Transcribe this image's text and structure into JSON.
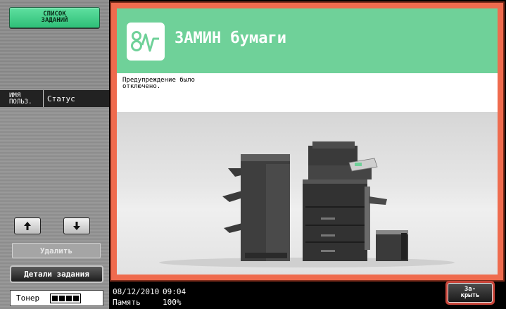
{
  "sidebar": {
    "job_list_label": "СПИСОК\nЗАДАНИЙ",
    "col_user": "ИМЯ\nПОЛЬЗ.",
    "col_status": "Статус",
    "up_icon": "arrow-up-icon",
    "down_icon": "arrow-down-icon",
    "delete_label": "Удалить",
    "details_label": "Детали задания",
    "toner_label": "Тонер",
    "toner_level_segments": 4
  },
  "main": {
    "title_icon": "paper-misfeed-icon",
    "title": "ЗАМИН бумаги",
    "message": "Предупреждение было\nотключено.",
    "accent_color": "#6fd199",
    "frame_color": "#ef6b4e"
  },
  "status_bar": {
    "date": "08/12/2010",
    "time": "09:04",
    "memory_label": "Память",
    "memory_value": "100%",
    "close_label": "За-\nкрыть"
  }
}
